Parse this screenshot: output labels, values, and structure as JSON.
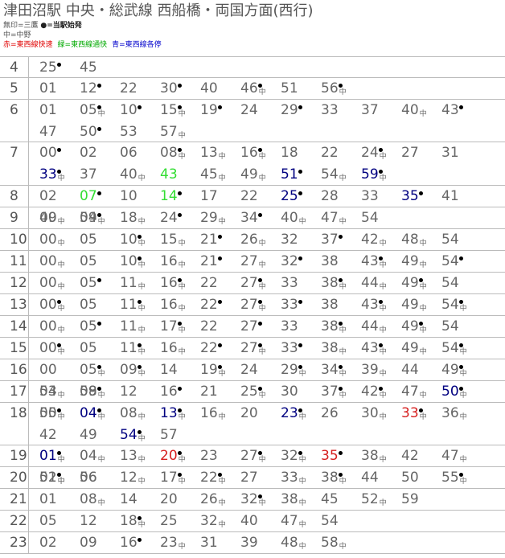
{
  "header": {
    "title": "津田沼駅 中央・総武線 西船橋・両国方面(西行)",
    "note1": "無印=三鷹 ",
    "note1_bold": "●=当駅始発",
    "note2": "中=中野",
    "legend": [
      {
        "text": "赤=東西線快速",
        "color": "#e00000"
      },
      {
        "text": "緑=東西線通快",
        "color": "#00aa00"
      },
      {
        "text": "青=東西線各停",
        "color": "#0000cc"
      }
    ]
  },
  "colors": {
    "red": "#d62020",
    "green": "#33dd33",
    "blue": "#000080",
    "normal": "#666666"
  },
  "rows": [
    {
      "hour": "4",
      "h": 26,
      "trains": [
        {
          "m": "25",
          "dot": true
        },
        {
          "m": "45"
        }
      ]
    },
    {
      "hour": "5",
      "h": 27,
      "trains": [
        {
          "m": "01"
        },
        {
          "m": "12",
          "dot": true
        },
        {
          "m": "22"
        },
        {
          "m": "30",
          "dot": true
        },
        {
          "m": "40"
        },
        {
          "m": "46",
          "tag": "中",
          "dot": true
        },
        {
          "m": "51"
        },
        {
          "m": "56",
          "tag": "中",
          "dot": true
        }
      ]
    },
    {
      "hour": "6",
      "h": 53,
      "trains": [
        {
          "m": "01"
        },
        {
          "m": "05",
          "tag": "中",
          "dot": true
        },
        {
          "m": "10",
          "dot": true
        },
        {
          "m": "15",
          "tag": "中",
          "dot": true
        },
        {
          "m": "19",
          "dot": true
        },
        {
          "m": "24"
        },
        {
          "m": "29",
          "dot": true
        },
        {
          "m": "33"
        },
        {
          "m": "37"
        },
        {
          "m": "40",
          "tag": "中"
        },
        {
          "m": "43",
          "dot": true
        },
        {
          "m": "47"
        },
        {
          "m": "50",
          "dot": true
        },
        {
          "m": "53"
        },
        {
          "m": "57",
          "tag": "中"
        }
      ]
    },
    {
      "hour": "7",
      "h": 54,
      "trains": [
        {
          "m": "00",
          "dot": true
        },
        {
          "m": "02"
        },
        {
          "m": "06"
        },
        {
          "m": "08",
          "tag": "中",
          "dot": true
        },
        {
          "m": "13",
          "tag": "中"
        },
        {
          "m": "16",
          "tag": "中",
          "dot": true
        },
        {
          "m": "18"
        },
        {
          "m": "22"
        },
        {
          "m": "24",
          "tag": "中",
          "dot": true
        },
        {
          "m": "27"
        },
        {
          "m": "31"
        },
        {
          "m": "33",
          "tag": "中",
          "dot": true,
          "color": "blue"
        },
        {
          "m": "37"
        },
        {
          "m": "40",
          "tag": "中"
        },
        {
          "m": "43",
          "color": "green"
        },
        {
          "m": "45",
          "tag": "中"
        },
        {
          "m": "49",
          "tag": "中"
        },
        {
          "m": "51",
          "dot": true,
          "color": "blue"
        },
        {
          "m": "54",
          "tag": "中"
        },
        {
          "m": "59",
          "tag": "中",
          "dot": true,
          "color": "blue"
        }
      ]
    },
    {
      "hour": "8",
      "h": 27,
      "trains": [
        {
          "m": "02"
        },
        {
          "m": "07",
          "dot": true,
          "color": "green"
        },
        {
          "m": "10"
        },
        {
          "m": "14",
          "dot": true,
          "color": "green"
        },
        {
          "m": "17"
        },
        {
          "m": "22"
        },
        {
          "m": "25",
          "dot": true,
          "color": "blue"
        },
        {
          "m": "28"
        },
        {
          "m": "33"
        },
        {
          "m": "35",
          "dot": true,
          "color": "blue"
        },
        {
          "m": "41"
        },
        {
          "m": "49",
          "tag": "中"
        },
        {
          "m": "54",
          "dot": true
        }
      ]
    },
    {
      "hour": "9",
      "h": 27,
      "trains": [
        {
          "m": "00"
        },
        {
          "m": "09",
          "tag": "中"
        },
        {
          "m": "18",
          "tag": "中"
        },
        {
          "m": "24",
          "dot": true
        },
        {
          "m": "29",
          "tag": "中"
        },
        {
          "m": "34",
          "dot": true
        },
        {
          "m": "40",
          "tag": "中"
        },
        {
          "m": "47",
          "tag": "中"
        },
        {
          "m": "54"
        }
      ]
    },
    {
      "hour": "10",
      "h": 27,
      "trains": [
        {
          "m": "00",
          "tag": "中"
        },
        {
          "m": "05"
        },
        {
          "m": "10",
          "tag": "中",
          "dot": true
        },
        {
          "m": "15",
          "tag": "中"
        },
        {
          "m": "21",
          "dot": true
        },
        {
          "m": "26",
          "tag": "中"
        },
        {
          "m": "32"
        },
        {
          "m": "37",
          "dot": true
        },
        {
          "m": "42",
          "tag": "中"
        },
        {
          "m": "48",
          "tag": "中"
        },
        {
          "m": "54"
        }
      ]
    },
    {
      "hour": "11",
      "h": 27,
      "trains": [
        {
          "m": "00",
          "tag": "中"
        },
        {
          "m": "05"
        },
        {
          "m": "10",
          "tag": "中",
          "dot": true
        },
        {
          "m": "16",
          "tag": "中"
        },
        {
          "m": "21",
          "dot": true
        },
        {
          "m": "27",
          "tag": "中"
        },
        {
          "m": "32",
          "dot": true
        },
        {
          "m": "38"
        },
        {
          "m": "43",
          "tag": "中",
          "dot": true
        },
        {
          "m": "49",
          "tag": "中"
        },
        {
          "m": "54",
          "dot": true
        }
      ]
    },
    {
      "hour": "12",
      "h": 27,
      "trains": [
        {
          "m": "00",
          "tag": "中"
        },
        {
          "m": "05",
          "dot": true
        },
        {
          "m": "11",
          "tag": "中"
        },
        {
          "m": "16",
          "tag": "中",
          "dot": true
        },
        {
          "m": "22"
        },
        {
          "m": "27",
          "tag": "中",
          "dot": true
        },
        {
          "m": "33"
        },
        {
          "m": "38",
          "tag": "中",
          "dot": true
        },
        {
          "m": "44",
          "tag": "中"
        },
        {
          "m": "49",
          "tag": "中",
          "dot": true
        },
        {
          "m": "54"
        }
      ]
    },
    {
      "hour": "13",
      "h": 27,
      "trains": [
        {
          "m": "00",
          "tag": "中",
          "dot": true
        },
        {
          "m": "05"
        },
        {
          "m": "11",
          "tag": "中",
          "dot": true
        },
        {
          "m": "16",
          "tag": "中"
        },
        {
          "m": "22",
          "dot": true
        },
        {
          "m": "27",
          "tag": "中",
          "dot": true
        },
        {
          "m": "33",
          "dot": true
        },
        {
          "m": "38"
        },
        {
          "m": "43",
          "tag": "中",
          "dot": true
        },
        {
          "m": "49",
          "tag": "中"
        },
        {
          "m": "54",
          "tag": "中",
          "dot": true
        }
      ]
    },
    {
      "hour": "14",
      "h": 27,
      "trains": [
        {
          "m": "00",
          "tag": "中"
        },
        {
          "m": "05",
          "dot": true
        },
        {
          "m": "11",
          "tag": "中"
        },
        {
          "m": "17",
          "tag": "中",
          "dot": true
        },
        {
          "m": "22"
        },
        {
          "m": "27",
          "dot": true
        },
        {
          "m": "33"
        },
        {
          "m": "38",
          "tag": "中",
          "dot": true
        },
        {
          "m": "44",
          "tag": "中"
        },
        {
          "m": "49",
          "tag": "中",
          "dot": true
        },
        {
          "m": "54"
        }
      ]
    },
    {
      "hour": "15",
      "h": 27,
      "trains": [
        {
          "m": "00",
          "tag": "中",
          "dot": true
        },
        {
          "m": "05"
        },
        {
          "m": "11",
          "tag": "中",
          "dot": true
        },
        {
          "m": "16",
          "tag": "中"
        },
        {
          "m": "22",
          "dot": true
        },
        {
          "m": "27",
          "tag": "中",
          "dot": true
        },
        {
          "m": "33",
          "dot": true
        },
        {
          "m": "38",
          "tag": "中"
        },
        {
          "m": "43",
          "tag": "中",
          "dot": true
        },
        {
          "m": "49",
          "tag": "中"
        },
        {
          "m": "54",
          "tag": "中",
          "dot": true
        }
      ]
    },
    {
      "hour": "16",
      "h": 27,
      "trains": [
        {
          "m": "00"
        },
        {
          "m": "05",
          "tag": "中",
          "dot": true
        },
        {
          "m": "09",
          "tag": "中",
          "dot": true
        },
        {
          "m": "14"
        },
        {
          "m": "19",
          "tag": "中",
          "dot": true
        },
        {
          "m": "24"
        },
        {
          "m": "29",
          "tag": "中",
          "dot": true
        },
        {
          "m": "34",
          "tag": "中",
          "dot": true
        },
        {
          "m": "39",
          "tag": "中"
        },
        {
          "m": "44"
        },
        {
          "m": "49",
          "tag": "中",
          "dot": true
        },
        {
          "m": "54"
        },
        {
          "m": "59"
        }
      ]
    },
    {
      "hour": "17",
      "h": 27,
      "trains": [
        {
          "m": "03",
          "tag": "中"
        },
        {
          "m": "08",
          "tag": "中",
          "dot": true
        },
        {
          "m": "12"
        },
        {
          "m": "16",
          "dot": true
        },
        {
          "m": "21"
        },
        {
          "m": "25",
          "tag": "中",
          "dot": true
        },
        {
          "m": "30"
        },
        {
          "m": "37",
          "tag": "中",
          "dot": true
        },
        {
          "m": "42",
          "tag": "中",
          "dot": true
        },
        {
          "m": "47",
          "tag": "中"
        },
        {
          "m": "50",
          "tag": "中",
          "dot": true,
          "color": "blue"
        },
        {
          "m": "55"
        }
      ]
    },
    {
      "hour": "18",
      "h": 53,
      "trains": [
        {
          "m": "00",
          "tag": "中",
          "dot": true
        },
        {
          "m": "04",
          "tag": "中",
          "dot": true,
          "color": "blue"
        },
        {
          "m": "08",
          "tag": "中"
        },
        {
          "m": "13",
          "tag": "中",
          "dot": true,
          "color": "blue"
        },
        {
          "m": "16",
          "tag": "中"
        },
        {
          "m": "20"
        },
        {
          "m": "23",
          "tag": "中",
          "dot": true,
          "color": "blue"
        },
        {
          "m": "26"
        },
        {
          "m": "30",
          "tag": "中"
        },
        {
          "m": "33",
          "tag": "中",
          "dot": true,
          "color": "red"
        },
        {
          "m": "36",
          "tag": "中"
        },
        {
          "m": "42"
        },
        {
          "m": "49"
        },
        {
          "m": "54",
          "tag": "中",
          "dot": true,
          "color": "blue"
        },
        {
          "m": "57"
        }
      ]
    },
    {
      "hour": "19",
      "h": 27,
      "trains": [
        {
          "m": "01",
          "tag": "中",
          "dot": true,
          "color": "blue"
        },
        {
          "m": "04",
          "tag": "中"
        },
        {
          "m": "13",
          "tag": "中"
        },
        {
          "m": "20",
          "tag": "中",
          "dot": true,
          "color": "red"
        },
        {
          "m": "23"
        },
        {
          "m": "27",
          "tag": "中",
          "dot": true
        },
        {
          "m": "32",
          "tag": "中",
          "dot": true
        },
        {
          "m": "35",
          "dot": true,
          "color": "red"
        },
        {
          "m": "38",
          "tag": "中"
        },
        {
          "m": "42"
        },
        {
          "m": "47",
          "tag": "中"
        },
        {
          "m": "52",
          "tag": "中",
          "dot": true
        },
        {
          "m": "56"
        }
      ]
    },
    {
      "hour": "20",
      "h": 27,
      "trains": [
        {
          "m": "01",
          "tag": "中"
        },
        {
          "m": "06"
        },
        {
          "m": "12",
          "tag": "中"
        },
        {
          "m": "17",
          "tag": "中",
          "dot": true
        },
        {
          "m": "22",
          "tag": "中",
          "dot": true
        },
        {
          "m": "27"
        },
        {
          "m": "33",
          "tag": "中"
        },
        {
          "m": "38",
          "tag": "中",
          "dot": true
        },
        {
          "m": "44"
        },
        {
          "m": "50"
        },
        {
          "m": "55",
          "tag": "中",
          "dot": true
        }
      ]
    },
    {
      "hour": "21",
      "h": 27,
      "trains": [
        {
          "m": "01"
        },
        {
          "m": "08",
          "tag": "中"
        },
        {
          "m": "14"
        },
        {
          "m": "20"
        },
        {
          "m": "26",
          "tag": "中"
        },
        {
          "m": "32",
          "tag": "中",
          "dot": true
        },
        {
          "m": "38",
          "tag": "中"
        },
        {
          "m": "45"
        },
        {
          "m": "52",
          "tag": "中"
        },
        {
          "m": "59"
        }
      ]
    },
    {
      "hour": "22",
      "h": 27,
      "trains": [
        {
          "m": "05"
        },
        {
          "m": "12"
        },
        {
          "m": "18",
          "tag": "中",
          "dot": true
        },
        {
          "m": "25"
        },
        {
          "m": "32",
          "tag": "中"
        },
        {
          "m": "40"
        },
        {
          "m": "47",
          "tag": "中"
        },
        {
          "m": "54"
        }
      ]
    },
    {
      "hour": "23",
      "h": 27,
      "trains": [
        {
          "m": "02"
        },
        {
          "m": "09"
        },
        {
          "m": "16",
          "dot": true
        },
        {
          "m": "23",
          "tag": "中"
        },
        {
          "m": "31"
        },
        {
          "m": "39"
        },
        {
          "m": "48",
          "tag": "中"
        },
        {
          "m": "58",
          "tag": "中"
        }
      ]
    }
  ]
}
